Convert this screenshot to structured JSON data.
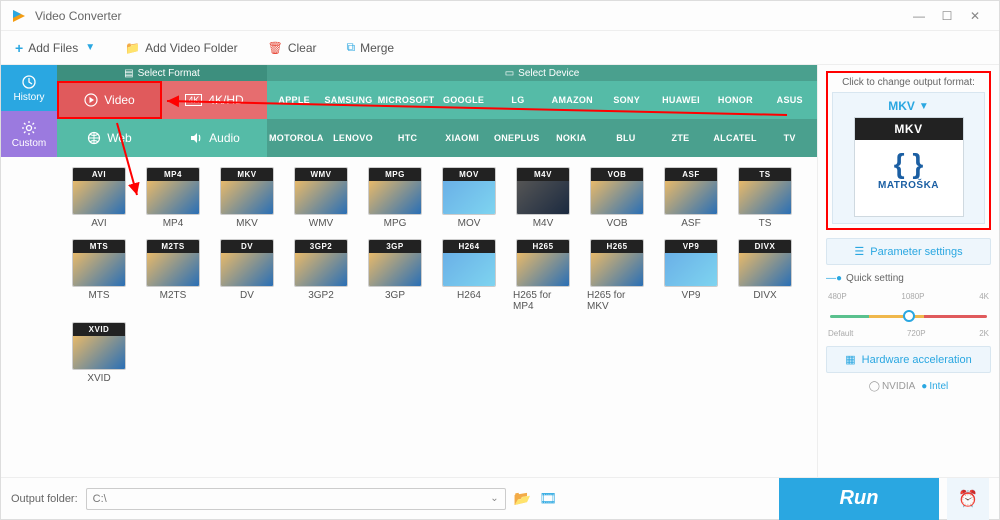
{
  "window": {
    "title": "Video Converter"
  },
  "toolbar": {
    "add_files": "Add Files",
    "add_folder": "Add Video Folder",
    "clear": "Clear",
    "merge": "Merge"
  },
  "nav": {
    "history": "History",
    "custom": "Custom"
  },
  "tabs": {
    "format_head": "Select Format",
    "device_head": "Select Device",
    "row1": {
      "video": "Video",
      "fourk": "4K/HD"
    },
    "row2": {
      "web": "Web",
      "audio": "Audio"
    },
    "brands_row1": [
      "Apple",
      "Samsung",
      "Microsoft",
      "Google",
      "LG",
      "amazon",
      "SONY",
      "Huawei",
      "honor",
      "ASUS"
    ],
    "brands_row2": [
      "Motorola",
      "Lenovo",
      "HTC",
      "Xiaomi",
      "OnePlus",
      "NOKIA",
      "BLU",
      "ZTE",
      "alcatel",
      "TV"
    ]
  },
  "formats": [
    "AVI",
    "MP4",
    "MKV",
    "WMV",
    "MPG",
    "MOV",
    "M4V",
    "VOB",
    "ASF",
    "TS",
    "MTS",
    "M2TS",
    "DV",
    "3GP2",
    "3GP",
    "H264",
    "H265 for MP4",
    "H265 for MKV",
    "VP9",
    "DIVX",
    "XVID"
  ],
  "right": {
    "hint": "Click to change output format:",
    "selected": "MKV",
    "matroska": "MATROŠKA",
    "param": "Parameter settings",
    "quick": "Quick setting",
    "ticks_top": [
      "480P",
      "1080P",
      "4K"
    ],
    "ticks_bot": [
      "Default",
      "720P",
      "2K"
    ],
    "hw": "Hardware acceleration",
    "nvidia": "NVIDIA",
    "intel": "Intel"
  },
  "footer": {
    "label": "Output folder:",
    "path": "C:\\",
    "run": "Run"
  }
}
